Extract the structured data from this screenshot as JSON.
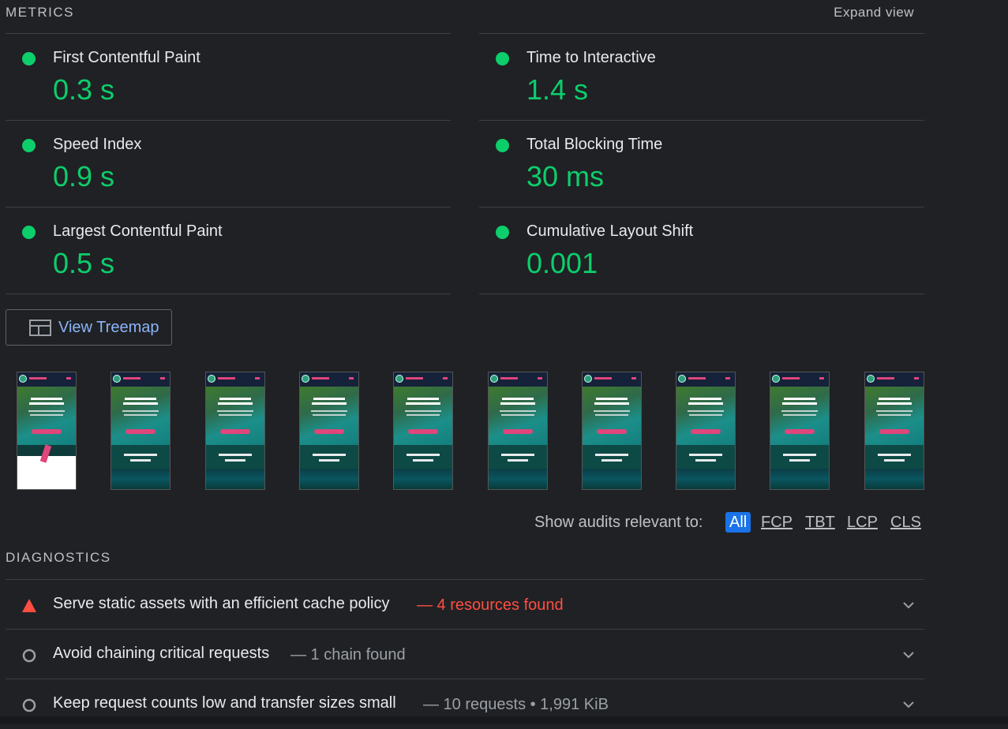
{
  "metrics": {
    "title": "METRICS",
    "expand_label": "Expand view",
    "status_color": "#0cce6b",
    "left": [
      {
        "label": "First Contentful Paint",
        "value": "0.3 s"
      },
      {
        "label": "Speed Index",
        "value": "0.9 s"
      },
      {
        "label": "Largest Contentful Paint",
        "value": "0.5 s"
      }
    ],
    "right": [
      {
        "label": "Time to Interactive",
        "value": "1.4 s"
      },
      {
        "label": "Total Blocking Time",
        "value": "30 ms"
      },
      {
        "label": "Cumulative Layout Shift",
        "value": "0.001"
      }
    ]
  },
  "treemap": {
    "label": "View Treemap",
    "icon": "treemap-icon"
  },
  "filmstrip": {
    "frame_count": 10
  },
  "filter": {
    "label": "Show audits relevant to:",
    "options": [
      "All",
      "FCP",
      "TBT",
      "LCP",
      "CLS"
    ],
    "active": "All"
  },
  "diagnostics": {
    "title": "DIAGNOSTICS",
    "items": [
      {
        "title": "Serve static assets with an efficient cache policy",
        "detail": "— 4 resources found",
        "status": "fail",
        "icon": "warning-triangle-icon"
      },
      {
        "title": "Avoid chaining critical requests",
        "detail": "— 1 chain found",
        "status": "info",
        "icon": "circle-outline-icon"
      },
      {
        "title": "Keep request counts low and transfer sizes small",
        "detail": "— 10 requests • 1,991 KiB",
        "status": "info",
        "icon": "circle-outline-icon"
      }
    ]
  },
  "colors": {
    "fail": "#ff4e42",
    "pass": "#0cce6b",
    "link": "#8ab4f8",
    "muted": "#9aa0a6"
  }
}
